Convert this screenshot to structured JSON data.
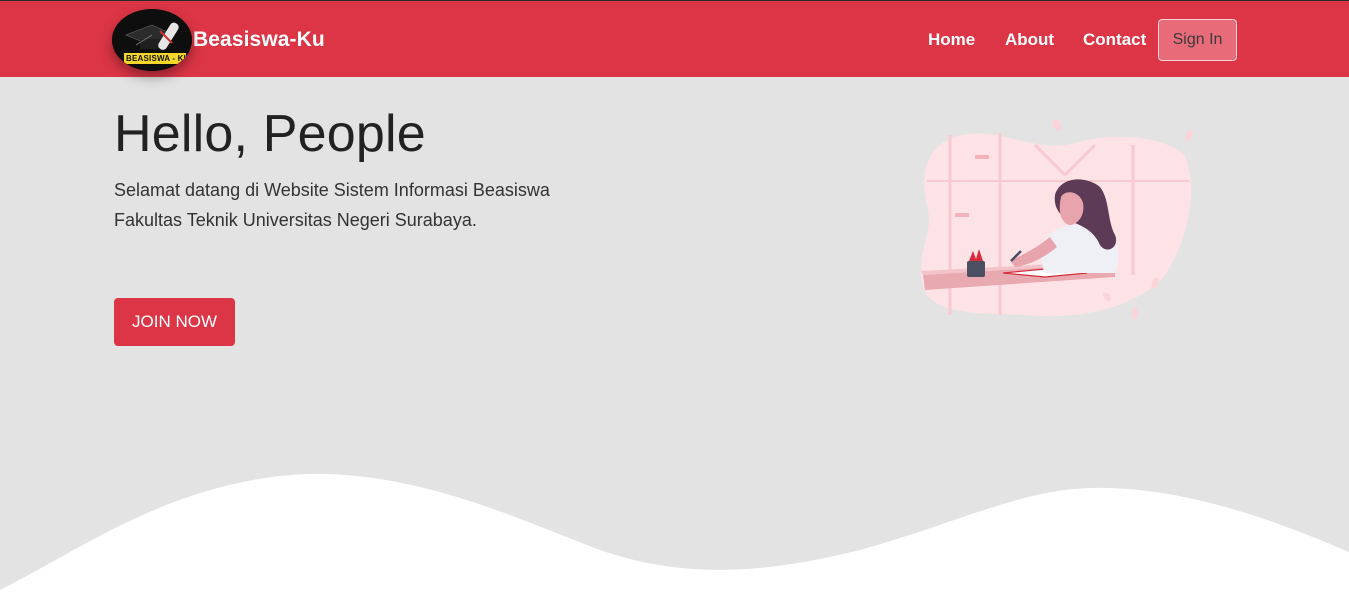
{
  "brand": {
    "name": "Beasiswa-Ku",
    "logo_text": "BEASISWA - KU"
  },
  "nav": {
    "home": "Home",
    "about": "About",
    "contact": "Contact",
    "signin": "Sign In"
  },
  "hero": {
    "title": "Hello, People",
    "line1": "Selamat datang di Website Sistem Informasi Beasiswa",
    "line2": "Fakultas Teknik Universitas Negeri Surabaya.",
    "cta": "JOIN NOW"
  },
  "colors": {
    "primary": "#dc3545",
    "background": "#e3e3e3",
    "signin_bg": "#e86b7a",
    "white": "#ffffff"
  },
  "icons": {
    "logo": "graduation-cap-icon",
    "illustration": "student-studying-illustration"
  }
}
